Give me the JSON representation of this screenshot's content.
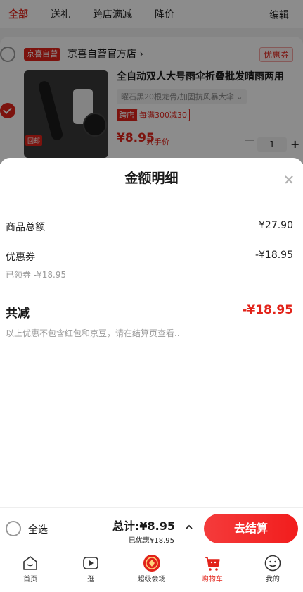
{
  "tabs": {
    "items": [
      "全部",
      "送礼",
      "跨店满减",
      "降价"
    ],
    "active_index": 0,
    "edit_label": "编辑"
  },
  "shop": {
    "badge": "京喜自营",
    "name": "京喜自营官方店 ›",
    "coupon_label": "优惠券"
  },
  "product": {
    "title": "全自动双人大号雨伞折叠批发晴雨两用",
    "spec": "曜石黑20根龙骨/加固抗风暴大伞 ⌄",
    "image_badge": "回邮",
    "tag": "跨店",
    "promo": "每满300减30",
    "price": "¥8.95",
    "price_note": "到手价",
    "quantity": "1",
    "checked": true
  },
  "detail": {
    "title": "金额明细",
    "goods_total_label": "商品总额",
    "goods_total_value": "¥27.90",
    "coupon_label": "优惠券",
    "coupon_value": "-¥18.95",
    "coupon_sub": "已领券 -¥18.95",
    "total_reduce_label": "共减",
    "total_reduce_value": "-¥18.95",
    "footnote": "以上优惠不包含红包和京豆，请在结算页查看.."
  },
  "checkout": {
    "select_all_label": "全选",
    "sum_label": "总计:¥8.95",
    "saved_label": "已优惠¥18.95",
    "button_label": "去结算"
  },
  "nav": {
    "items": [
      {
        "label": "首页",
        "icon": "home-icon"
      },
      {
        "label": "逛",
        "icon": "video-icon"
      },
      {
        "label": "超级会场",
        "icon": "super-venue-icon"
      },
      {
        "label": "购物车",
        "icon": "cart-icon"
      },
      {
        "label": "我的",
        "icon": "profile-icon"
      }
    ],
    "active_index": 3
  },
  "colors": {
    "accent": "#e2231a",
    "checkout_gradient_start": "#f43b3b",
    "checkout_gradient_end": "#f21d1d"
  }
}
